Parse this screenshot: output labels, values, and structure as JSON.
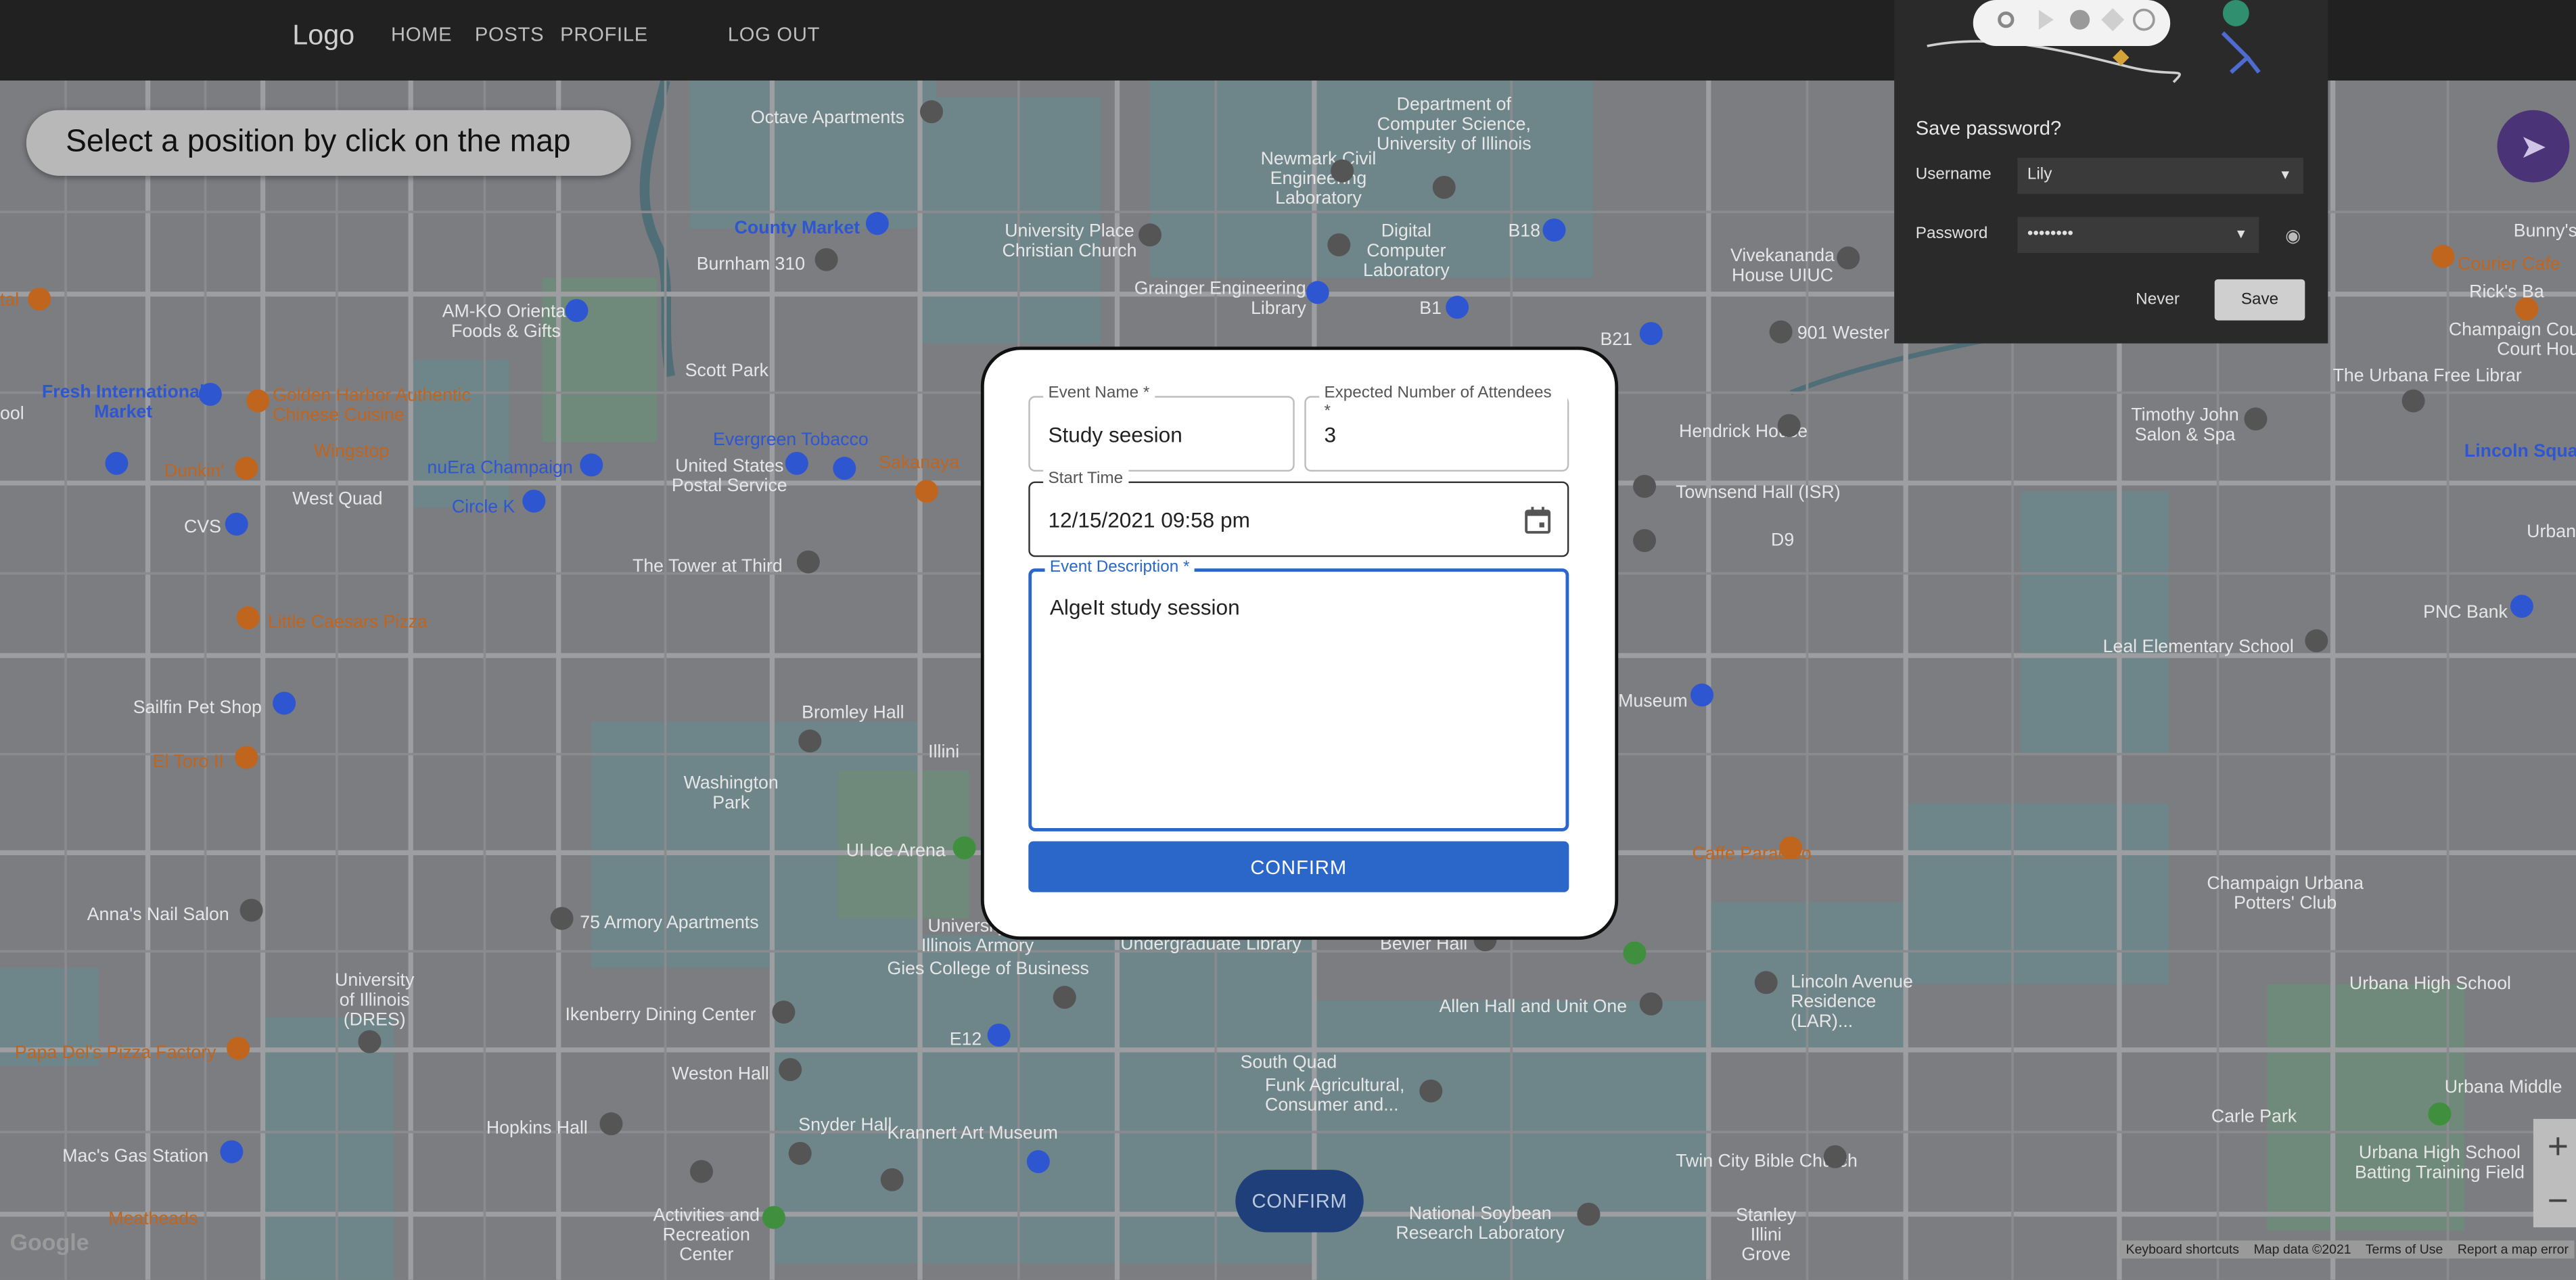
{
  "nav": {
    "logo": "Logo",
    "home": "HOME",
    "posts": "POSTS",
    "profile": "PROFILE",
    "logout": "LOG OUT"
  },
  "map": {
    "banner": "Select a position by click on the map",
    "confirm_label": "CONFIRM",
    "footer": {
      "shortcuts": "Keyboard shortcuts",
      "data": "Map data ©2021",
      "terms": "Terms of Use",
      "report": "Report a map error"
    },
    "google": "Google",
    "zoom_in": "+",
    "zoom_out": "−",
    "places": {
      "octave": "Octave Apartments",
      "county_market": "County Market",
      "burnham": "Burnham 310",
      "amko": "AM-KO Oriental Foods & Gifts",
      "fresh_intl": "Fresh International Market",
      "golden_harbor": "Golden Harbor Authentic Chinese Cuisine",
      "wingstop": "Wingstop",
      "dunkin": "Dunkin'",
      "west_quad": "West Quad",
      "nuera": "nuEra Champaign",
      "circle_k": "Circle K",
      "cvs": "CVS",
      "little_caesars": "Little Caesars Pizza",
      "sailfin": "Sailfin Pet Shop",
      "el_toro": "El Toro II",
      "annas": "Anna's Nail Salon",
      "uiuc_dres": "University of Illinois (DRES)",
      "papa_dels": "Papa Del's Pizza Factory",
      "macs_gas": "Mac's Gas Station",
      "meatheads": "Meatheads",
      "scott_park": "Scott Park",
      "evergreen": "Evergreen Tobacco",
      "postal": "United States Postal Service",
      "sakanaya": "Sakanaya",
      "tower_third": "The Tower at Third",
      "bromley": "Bromley Hall",
      "washington_park": "Washington Park",
      "ui_ice_arena": "UI Ice Arena",
      "armory_apts": "75 Armory Apartments",
      "ui_armory": "University of Illinois Armory",
      "gies": "Gies College of Business",
      "ikenberry": "Ikenberry Dining Center",
      "weston": "Weston Hall",
      "hopkins": "Hopkins Hall",
      "snyder": "Snyder Hall",
      "activities": "Activities and Recreation Center",
      "krannert": "Krannert Art Museum",
      "undergrad_lib": "Undergraduate Library",
      "bevier": "Bevier Hall",
      "e12": "E12",
      "south_quad": "South Quad",
      "funk": "Funk Agricultural, Consumer and...",
      "national_soybean": "National Soybean Research Laboratory",
      "allen_hall": "Allen Hall and Unit One",
      "twin_city": "Twin City Bible Church",
      "stanley": "Stanley Illini Grove",
      "lincoln_ave": "Lincoln Avenue Residence (LAR)...",
      "caffe_paradiso": "Caffe Paradiso",
      "champaign_potters": "Champaign Urbana Potters' Club",
      "urbana_high": "Urbana High School",
      "urbana_middle": "Urbana Middle",
      "carle_park": "Carle Park",
      "urbana_batting": "Urbana High School Batting Training Field",
      "leal": "Leal Elementary School",
      "pnc": "PNC Bank",
      "lincoln_square": "Lincoln Squa",
      "urbana_free": "The Urbana Free Librar",
      "champaign_county": "Champaign Cou Court Hou",
      "ricks": "Rick's Ba",
      "bunnys": "Bunny's",
      "courier": "Courier Cafe",
      "vivekananda": "Vivekananda House UIUC",
      "timothy": "Timothy John Salon & Spa",
      "hendrick": "Hendrick House",
      "townsend": "Townsend Hall (ISR)",
      "d9": "D9",
      "museum": "Museum",
      "newmark": "Newmark Civil Engineering Laboratory",
      "dcs": "Department of Computer Science, University of Illinois",
      "univ_place": "University Place Christian Church",
      "digital_lab": "Digital Computer Laboratory",
      "grainger": "Grainger Engineering Library",
      "b18": "B18",
      "b1": "B1",
      "b21": "B21",
      "west_901": "901 Wester",
      "ital": "tal",
      "pool": "ool",
      "urban": "Urban",
      "ellin": "Illini"
    }
  },
  "dialog": {
    "event_name_label": "Event Name *",
    "event_name_value": "Study seesion",
    "attendees_label": "Expected Number of Attendees *",
    "attendees_value": "3",
    "start_time_label": "Start Time",
    "start_time_value": "12/15/2021 09:58 pm",
    "description_label": "Event Description *",
    "description_value": "AlgeIt study session",
    "confirm_label": "CONFIRM"
  },
  "password_popup": {
    "title": "Save password?",
    "username_label": "Username",
    "username_value": "Lily",
    "password_label": "Password",
    "password_value": "••••••••",
    "never_label": "Never",
    "save_label": "Save"
  },
  "colors": {
    "accent": "#2b67c9",
    "topbar": "#212121",
    "map_bg": "#7c7d80",
    "compass": "#4a3376"
  }
}
